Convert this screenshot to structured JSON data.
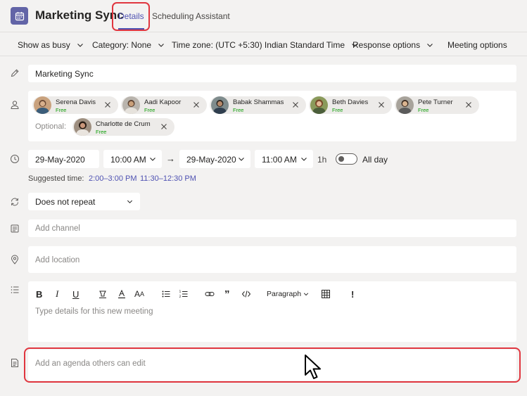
{
  "header": {
    "title": "Marketing Sync",
    "tabs": [
      {
        "label": "Details",
        "active": true
      },
      {
        "label": "Scheduling Assistant",
        "active": false
      }
    ]
  },
  "toolbar": {
    "show_as": "Show as busy",
    "category": "Category: None",
    "time_zone": "Time zone: (UTC +5:30) Indian Standard Time",
    "response_options": "Response options",
    "meeting_options": "Meeting options"
  },
  "form": {
    "title_value": "Marketing Sync",
    "required_attendees": [
      {
        "name": "Serena Davis",
        "status": "Free"
      },
      {
        "name": "Aadi Kapoor",
        "status": "Free"
      },
      {
        "name": "Babak Shammas",
        "status": "Free"
      },
      {
        "name": "Beth Davies",
        "status": "Free"
      },
      {
        "name": "Pete Turner",
        "status": "Free"
      }
    ],
    "optional_label": "Optional:",
    "optional_attendees": [
      {
        "name": "Charlotte de Crum",
        "status": "Free"
      }
    ],
    "start_date": "29-May-2020",
    "start_time": "10:00 AM",
    "end_date": "29-May-2020",
    "end_time": "11:00 AM",
    "duration": "1h",
    "all_day_label": "All day",
    "suggested_label": "Suggested time:",
    "suggested_times": [
      "2:00–3:00 PM",
      "11:30–12:30 PM"
    ],
    "repeat": "Does not repeat",
    "channel_placeholder": "Add channel",
    "location_placeholder": "Add location",
    "editor_placeholder": "Type details for this new meeting",
    "paragraph_label": "Paragraph",
    "agenda_placeholder": "Add an agenda others can edit"
  },
  "colors": {
    "accent": "#6264a7",
    "link": "#4f52b2",
    "callout": "#e0363f",
    "free": "#13a10e"
  }
}
